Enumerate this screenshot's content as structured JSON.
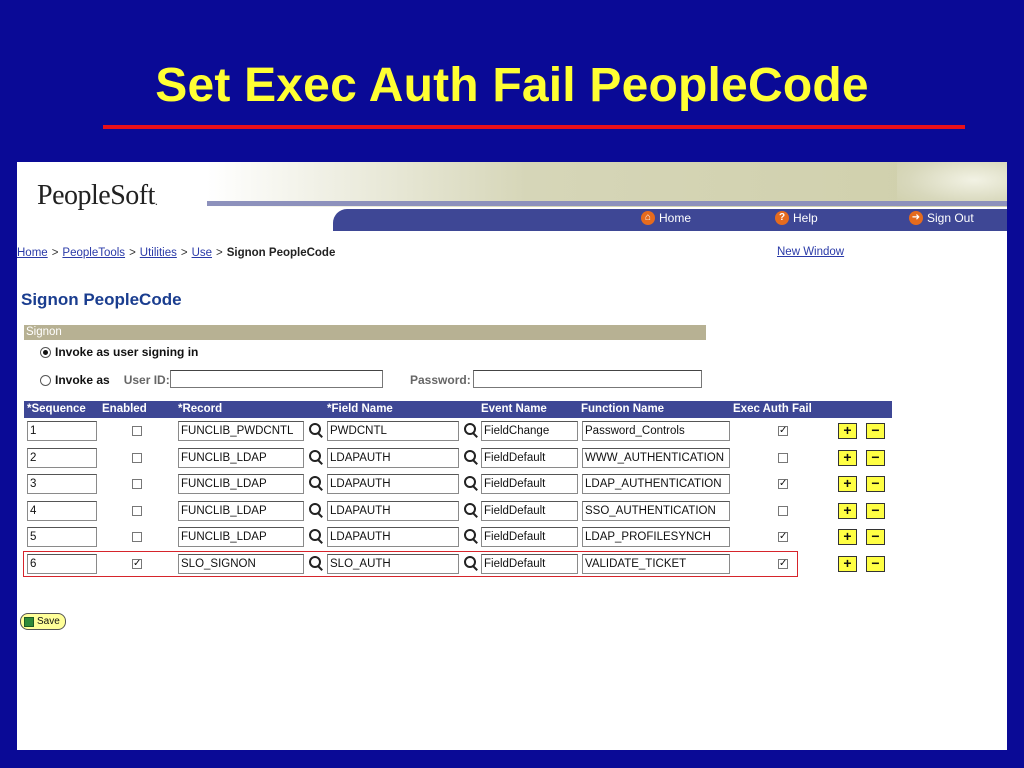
{
  "slide": {
    "title": "Set Exec Auth Fail PeopleCode"
  },
  "colors": {
    "slide_bg": "#0a0a96",
    "title": "#ffff33",
    "accent_rule": "#e8101a",
    "nav_bar": "#3e4795",
    "group_bar": "#b7b193",
    "highlight": "#d6242b"
  },
  "app": {
    "logo": "PeopleSoft",
    "logo_dot": "."
  },
  "nav": {
    "home": {
      "label": "Home",
      "icon": "home-icon"
    },
    "help": {
      "label": "Help",
      "icon": "help-icon"
    },
    "signout": {
      "label": "Sign Out",
      "icon": "signout-icon"
    }
  },
  "breadcrumb": {
    "home": "Home",
    "peopletools": "PeopleTools",
    "utilities": "Utilities",
    "use": "Use",
    "current": "Signon PeopleCode",
    "sep": ">"
  },
  "new_window": "New Window",
  "page_title": "Signon PeopleCode",
  "group": {
    "title": "Signon",
    "invoke_as_user": "Invoke as user signing in",
    "invoke_as": "Invoke as",
    "user_id_label": "User ID:",
    "password_label": "Password:",
    "user_id_value": "",
    "password_value": ""
  },
  "grid": {
    "headers": {
      "sequence": "*Sequence",
      "enabled": "Enabled",
      "record": "*Record",
      "field_name": "*Field Name",
      "event_name": "Event Name",
      "function_name": "Function Name",
      "exec_auth_fail": "Exec Auth Fail"
    },
    "rows": [
      {
        "sequence": "1",
        "enabled": "",
        "record": "FUNCLIB_PWDCNTL",
        "field": "PWDCNTL",
        "event": "FieldChange",
        "function": "Password_Controls",
        "exec_auth_fail": "✓"
      },
      {
        "sequence": "2",
        "enabled": "",
        "record": "FUNCLIB_LDAP",
        "field": "LDAPAUTH",
        "event": "FieldDefault",
        "function": "WWW_AUTHENTICATION",
        "exec_auth_fail": ""
      },
      {
        "sequence": "3",
        "enabled": "",
        "record": "FUNCLIB_LDAP",
        "field": "LDAPAUTH",
        "event": "FieldDefault",
        "function": "LDAP_AUTHENTICATION",
        "exec_auth_fail": "✓"
      },
      {
        "sequence": "4",
        "enabled": "",
        "record": "FUNCLIB_LDAP",
        "field": "LDAPAUTH",
        "event": "FieldDefault",
        "function": "SSO_AUTHENTICATION",
        "exec_auth_fail": ""
      },
      {
        "sequence": "5",
        "enabled": "",
        "record": "FUNCLIB_LDAP",
        "field": "LDAPAUTH",
        "event": "FieldDefault",
        "function": "LDAP_PROFILESYNCH",
        "exec_auth_fail": "✓"
      },
      {
        "sequence": "6",
        "enabled": "✓",
        "record": "SLO_SIGNON",
        "field": "SLO_AUTH",
        "event": "FieldDefault",
        "function": "VALIDATE_TICKET",
        "exec_auth_fail": "✓"
      }
    ],
    "add_label": "+",
    "remove_label": "−"
  },
  "save_label": "Save"
}
